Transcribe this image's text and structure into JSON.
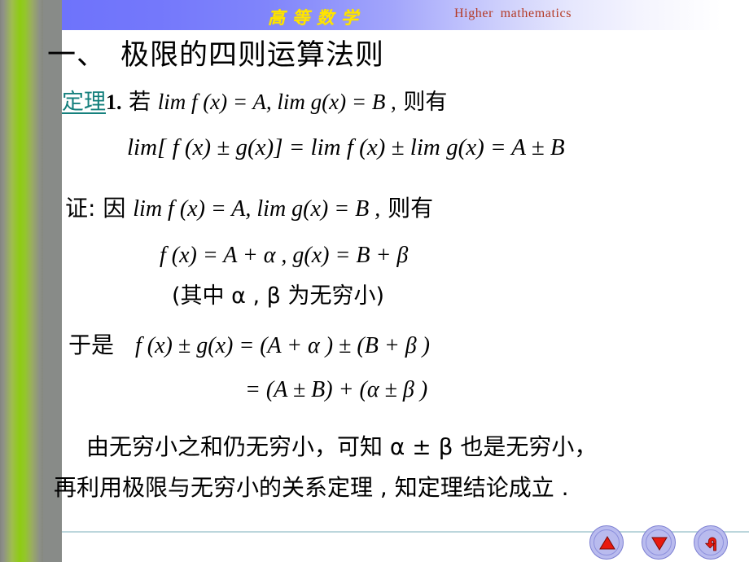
{
  "slide": {
    "header": {
      "brand_cn": "高等数学",
      "brand_en": "Higher  mathematics",
      "brand_cn_color": "#ffe400",
      "brand_en_color": "#b43a26",
      "band_start_color": "#6e73fb",
      "band_end_color": "#ffffff"
    },
    "sidebar": {
      "gray_color": "#888b88",
      "green_color": "#8ecc12"
    },
    "title": {
      "marker": "一、",
      "text": "极限的四则运算法则"
    },
    "theorem": {
      "label": "定理",
      "label_color": "#15807d",
      "number": "1",
      "period": ".",
      "statement_prefix": "若",
      "hypothesis": "lim f (x) = A, lim g(x) = B ,",
      "statement_suffix": "则有",
      "formula": "lim[ f (x) ± g(x)] = lim f (x) ± lim g(x) = A ± B"
    },
    "proof": {
      "label": "证:",
      "lead": "因",
      "hypothesis": "lim f (x) = A, lim g(x) = B ,",
      "lead_suffix": "则有",
      "line_decomposition": "f (x) = A + α ,  g(x) = B + β",
      "line_note": "(其中 α , β 为无穷小)",
      "therefore_label": "于是",
      "line_sum": "f (x) ± g(x) = (A + α ) ± (B + β )",
      "line_regroup": "= (A ± B) + (α ± β )",
      "conclusion_line1": "由无穷小之和仍无穷小，可知 α ± β 也是无穷小，",
      "conclusion_line2": "再利用极限与无穷小的关系定理 , 知定理结论成立 ."
    },
    "footer": {
      "rule_color": "#bcd6dc",
      "nav": [
        {
          "name": "previous",
          "icon": "triangle-up-icon",
          "label": "▲"
        },
        {
          "name": "next",
          "icon": "triangle-down-icon",
          "label": "▼"
        },
        {
          "name": "return",
          "icon": "return-arrow-icon",
          "label": "↰"
        }
      ],
      "nav_icon_color": "#e8190f",
      "nav_button_color": "#b9bbee"
    }
  }
}
